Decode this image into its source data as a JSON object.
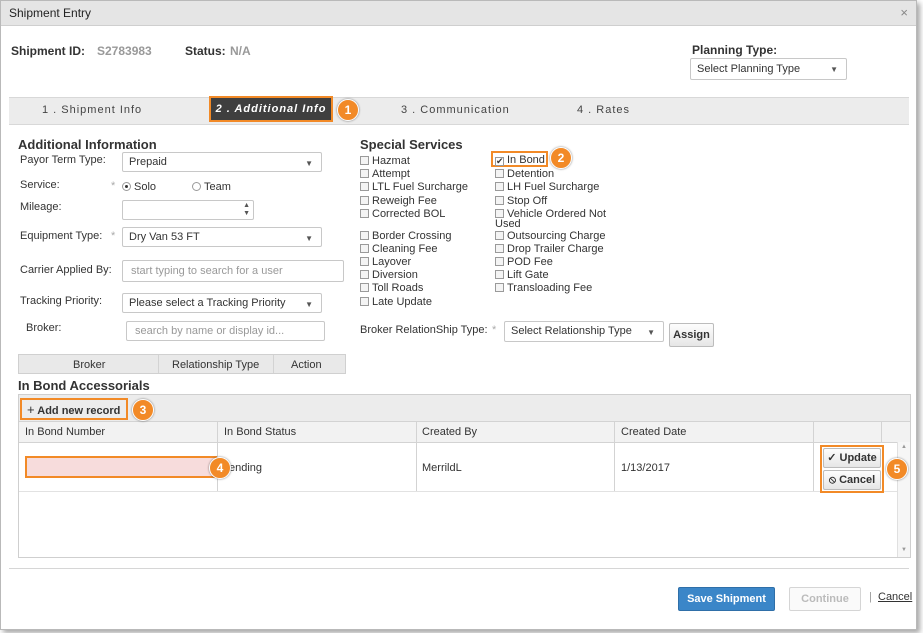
{
  "window": {
    "title": "Shipment Entry",
    "close": "×"
  },
  "header": {
    "shipment_id_label": "Shipment ID:",
    "shipment_id_value": "S2783983",
    "status_label": "Status:",
    "status_value": "N/A",
    "planning_type_label": "Planning Type:",
    "planning_type_select": "Select Planning Type"
  },
  "tabs": [
    {
      "label": "1 . Shipment Info"
    },
    {
      "label": "2 . Additional Info"
    },
    {
      "label": "3 . Communication"
    },
    {
      "label": "4 . Rates"
    }
  ],
  "badges": {
    "b1": "1",
    "b2": "2",
    "b3": "3",
    "b4": "4",
    "b5": "5"
  },
  "additional": {
    "title": "Additional Information",
    "payor_label": "Payor Term Type:",
    "payor_value": "Prepaid",
    "service_label": "Service:",
    "service_solo": "Solo",
    "service_team": "Team",
    "mileage_label": "Mileage:",
    "equipment_label": "Equipment Type:",
    "equipment_value": "Dry Van 53 FT",
    "carrier_label": "Carrier Applied By:",
    "carrier_placeholder": "start typing to search for a user",
    "tracking_label": "Tracking Priority:",
    "tracking_value": "Please select a Tracking Priority",
    "broker_label": "Broker:",
    "broker_placeholder": "search by name or display id...",
    "star": "*"
  },
  "broker_table": {
    "col1": "Broker",
    "col2": "Relationship Type",
    "col3": "Action"
  },
  "special": {
    "title": "Special Services",
    "left": [
      "Hazmat",
      "Attempt",
      "LTL Fuel Surcharge",
      "Reweigh Fee",
      "Corrected BOL",
      "Border Crossing",
      "Cleaning Fee",
      "Layover",
      "Diversion",
      "Toll Roads",
      "Late Update"
    ],
    "right": [
      "In Bond",
      "Detention",
      "LH Fuel Surcharge",
      "Stop Off",
      "Vehicle Ordered Not",
      "Used",
      "Outsourcing Charge",
      "Drop Trailer Charge",
      "POD Fee",
      "Lift Gate",
      "Transloading Fee"
    ],
    "broker_rel_label": "Broker RelationShip Type:",
    "broker_rel_value": "Select Relationship Type",
    "assign": "Assign"
  },
  "inbond": {
    "title": "In Bond Accessorials",
    "add": "Add new record",
    "plus": "+",
    "cols": [
      "In Bond Number",
      "In Bond Status",
      "Created By",
      "Created Date"
    ],
    "row": {
      "status": "ending",
      "created_by": "MerrildL",
      "created_date": "1/13/2017"
    },
    "update": "Update",
    "cancel": "Cancel",
    "update_icon": "✓",
    "cancel_icon": "⦸"
  },
  "footer": {
    "save": "Save Shipment",
    "continue": "Continue",
    "sep": "|",
    "cancel": "Cancel"
  },
  "colors": {
    "accent_orange": "#f28a27",
    "primary_blue": "#3b86c8",
    "tab_dark": "#3f3f3f"
  }
}
